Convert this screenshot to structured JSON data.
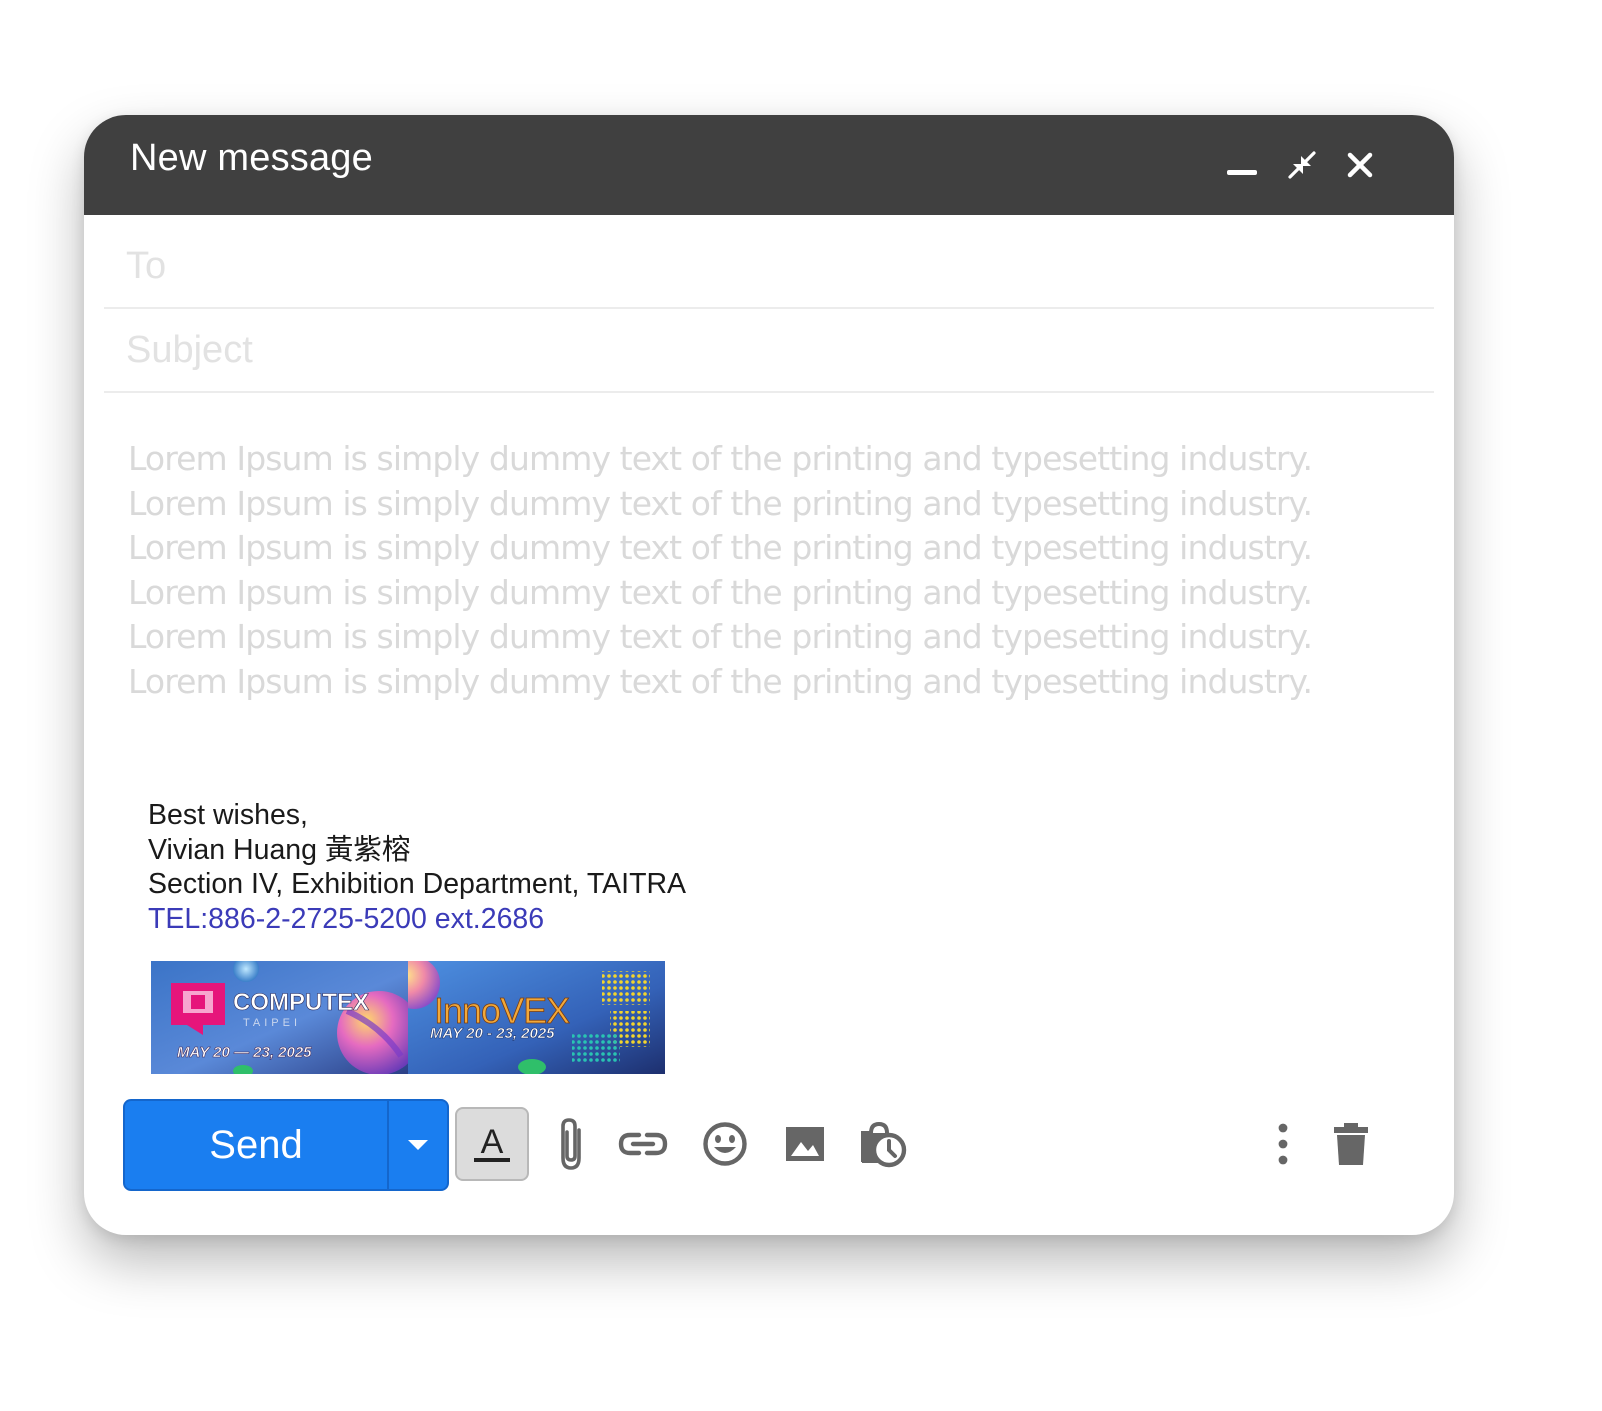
{
  "window": {
    "title": "New message",
    "controls": [
      "minimize-icon",
      "exit-fullscreen-icon",
      "close-icon"
    ]
  },
  "fields": {
    "to_placeholder": "To",
    "to_value": "",
    "subject_placeholder": "Subject",
    "subject_value": ""
  },
  "body": {
    "paragraphs": [
      "Lorem Ipsum is  simply dummy text of the printing and typesetting industry. Lorem Ipsum is  simply dummy text of the printing and typesetting industry. Lorem Ipsum is simply dummy text of the printing and typesetting industry.",
      "Lorem Ipsum is  simply dummy text of the printing and typesetting industry. Lorem Ipsum is  simply dummy text of the printing and typesetting industry. Lorem Ipsum is simply dummy text of the printing and typesetting industry."
    ]
  },
  "signature": {
    "greeting": "Best wishes,",
    "name": "Vivian Huang 黃紫榕",
    "department": "Section IV, Exhibition Department, TAITRA",
    "tel": "TEL:886-2-2725-5200 ext.2686",
    "banners": [
      {
        "brand": "COMPUTEX",
        "sub": "TAIPEI",
        "dates": "MAY 20 — 23, 2025"
      },
      {
        "brand": "InnoVEX",
        "dates": "MAY 20 - 23, 2025"
      }
    ]
  },
  "toolbar": {
    "send_label": "Send",
    "tools": [
      "send-options-icon",
      "text-format-icon",
      "attach-icon",
      "link-icon",
      "emoji-icon",
      "image-icon",
      "schedule-icon",
      "more-options-icon",
      "trash-icon"
    ]
  },
  "colors": {
    "titlebar": "#404040",
    "send_button": "#1a7ef0",
    "link": "#3b3bb8",
    "placeholder_text": "#d9d9d9"
  }
}
